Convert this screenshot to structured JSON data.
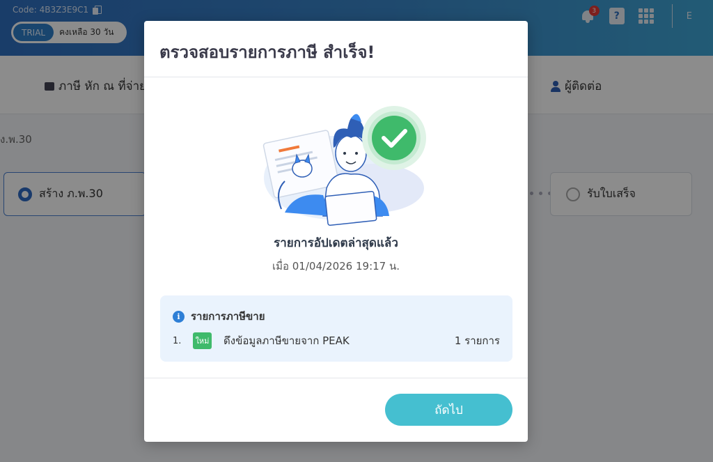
{
  "header": {
    "code_label": "Code: 4B3Z3E9C1",
    "trial_badge": "TRIAL",
    "trial_days": "คงเหลือ 30 วัน",
    "notification_count": "3",
    "help_glyph": "?",
    "lang": "E"
  },
  "nav": {
    "items": [
      {
        "label": "ภาษี หัก ณ ที่จ่าย",
        "icon": "wallet-icon"
      },
      {
        "label": "ผู้ติดต่อ",
        "icon": "user-icon"
      }
    ]
  },
  "breadcrumb": "ง.พ.30",
  "steps": [
    {
      "label": "สร้าง ภ.พ.30",
      "active": true
    },
    {
      "label": "รับใบเสร็จ",
      "active": false
    }
  ],
  "modal": {
    "title": "ตรวจสอบรายการภาษี สำเร็จ!",
    "updated_title": "รายการอัปเดตล่าสุดแล้ว",
    "updated_time": "เมื่อ 01/04/2026 19:17 น.",
    "info": {
      "heading": "รายการภาษีขาย",
      "icon": "info-icon",
      "rows": [
        {
          "number": "1.",
          "tag": "ใหม่",
          "description": "ดึงข้อมูลภาษีขายจาก PEAK",
          "count": "1 รายการ"
        }
      ]
    },
    "next_button": "ถัดไป"
  },
  "colors": {
    "header_gradient_start": "#2f6fc0",
    "header_gradient_end": "#3fa6d6",
    "success_green": "#3fba6b",
    "primary_button": "#45bfd0",
    "info_bg": "#eaf3fd"
  }
}
